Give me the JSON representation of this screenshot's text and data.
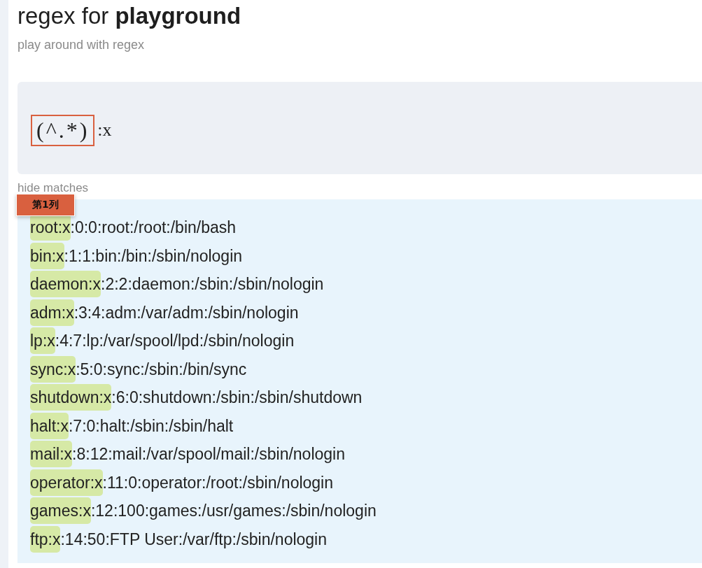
{
  "title": "regex for **playground**",
  "subtitle": "play around with regex",
  "pattern": [
    {
      "kind": "group",
      "text": "(^.*)"
    },
    {
      "kind": "literal",
      "text": ":x"
    }
  ],
  "hide_matches_label": "hide matches",
  "tooltip": "第1列",
  "lines": [
    {
      "match": "root:x",
      "rest": ":0:0:root:/root:/bin/bash"
    },
    {
      "match": "bin:x",
      "rest": ":1:1:bin:/bin:/sbin/nologin"
    },
    {
      "match": "daemon:x",
      "rest": ":2:2:daemon:/sbin:/sbin/nologin"
    },
    {
      "match": "adm:x",
      "rest": ":3:4:adm:/var/adm:/sbin/nologin"
    },
    {
      "match": "lp:x",
      "rest": ":4:7:lp:/var/spool/lpd:/sbin/nologin"
    },
    {
      "match": "sync:x",
      "rest": ":5:0:sync:/sbin:/bin/sync"
    },
    {
      "match": "shutdown:x",
      "rest": ":6:0:shutdown:/sbin:/sbin/shutdown"
    },
    {
      "match": "halt:x",
      "rest": ":7:0:halt:/sbin:/sbin/halt"
    },
    {
      "match": "mail:x",
      "rest": ":8:12:mail:/var/spool/mail:/sbin/nologin"
    },
    {
      "match": "operator:x",
      "rest": ":11:0:operator:/root:/sbin/nologin"
    },
    {
      "match": "games:x",
      "rest": ":12:100:games:/usr/games:/sbin/nologin"
    },
    {
      "match": "ftp:x",
      "rest": ":14:50:FTP User:/var/ftp:/sbin/nologin"
    }
  ]
}
